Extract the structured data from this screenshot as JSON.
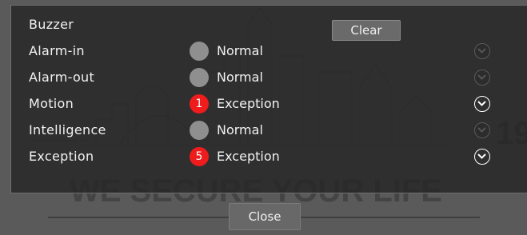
{
  "background": {
    "slogan": "WE SECURE YOUR LIFE"
  },
  "colors": {
    "panel": "#262626",
    "dot_normal": "#8f8f8f",
    "dot_alert": "#ee1c1c"
  },
  "buzzer": {
    "label": "Buzzer",
    "clear_label": "Clear"
  },
  "rows": [
    {
      "label": "Alarm-in",
      "status": "Normal",
      "count": "",
      "alert": false,
      "icon": "chevron-down-icon"
    },
    {
      "label": "Alarm-out",
      "status": "Normal",
      "count": "",
      "alert": false,
      "icon": "chevron-down-icon"
    },
    {
      "label": "Motion",
      "status": "Exception",
      "count": "1",
      "alert": true,
      "icon": "chevron-down-icon"
    },
    {
      "label": "Intelligence",
      "status": "Normal",
      "count": "",
      "alert": false,
      "icon": "chevron-down-icon"
    },
    {
      "label": "Exception",
      "status": "Exception",
      "count": "5",
      "alert": true,
      "icon": "chevron-down-icon"
    }
  ],
  "footer": {
    "close_label": "Close"
  }
}
